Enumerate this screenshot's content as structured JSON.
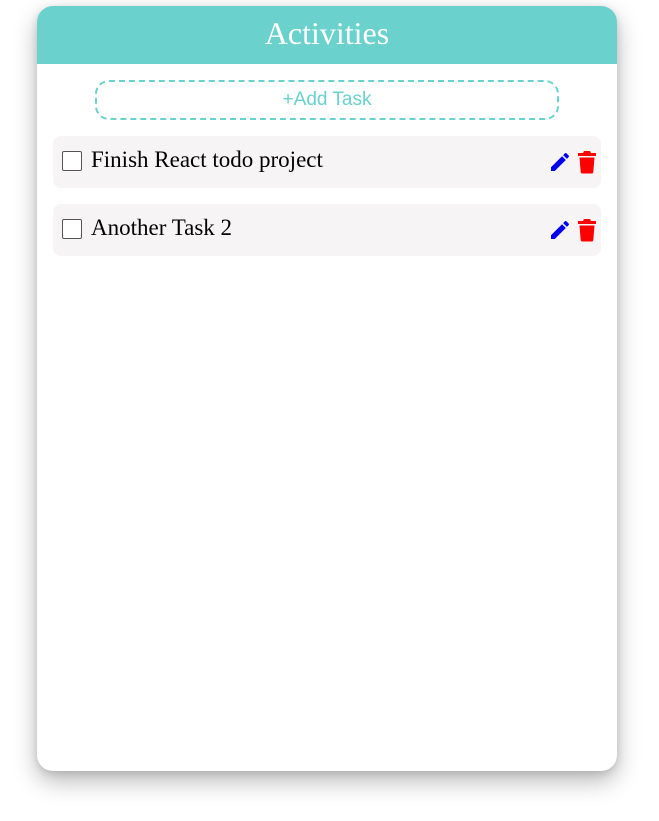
{
  "header": {
    "title": "Activities",
    "color": "#6ad1cc"
  },
  "add_task": {
    "label": "+Add Task"
  },
  "tasks": [
    {
      "label": "Finish React todo project",
      "checked": false,
      "edit_icon": "pencil-icon",
      "delete_icon": "trash-icon"
    },
    {
      "label": "Another Task 2",
      "checked": false,
      "edit_icon": "pencil-icon",
      "delete_icon": "trash-icon"
    }
  ],
  "colors": {
    "accent": "#6ad1cc",
    "edit": "#0000ee",
    "delete": "#ff0000",
    "task_bg": "#f6f4f5"
  }
}
